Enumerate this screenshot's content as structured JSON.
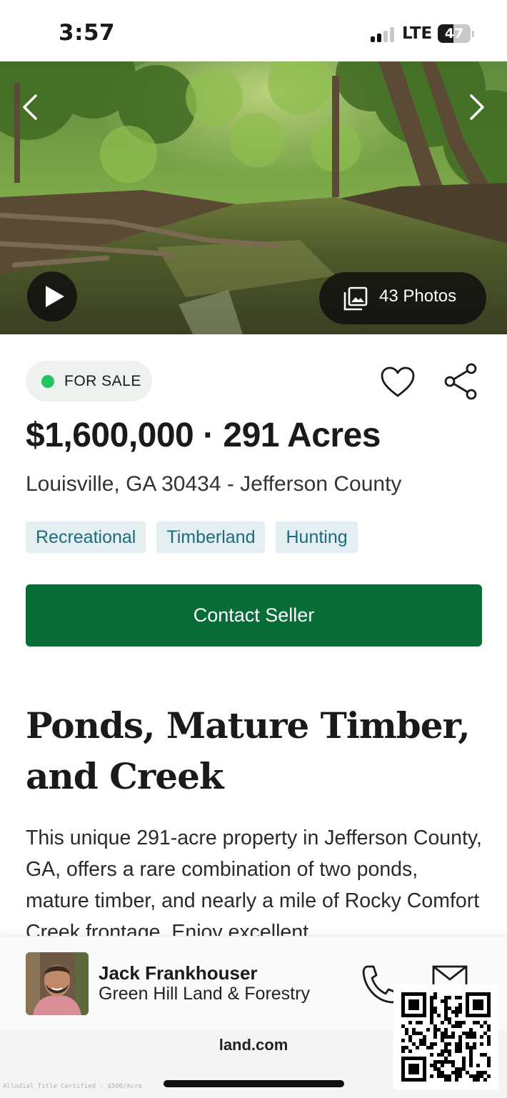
{
  "status_bar": {
    "time": "3:57",
    "network": "LTE",
    "battery": "47",
    "battery_level": 0.47
  },
  "gallery": {
    "photos_label": "43 Photos",
    "prev_icon": "chevron-left-icon",
    "next_icon": "chevron-right-icon",
    "play_icon": "play-icon",
    "photos_icon": "gallery-icon"
  },
  "listing": {
    "status": "FOR SALE",
    "price_line": "$1,600,000 · 291 Acres",
    "address": "Louisville, GA 30434 - Jefferson County",
    "tags": [
      "Recreational",
      "Timberland",
      "Hunting"
    ],
    "contact_label": "Contact Seller",
    "headline": "Ponds, Mature Timber, and Creek",
    "description": "This unique 291-acre property in Jefferson County, GA, offers a rare combination of two ponds, mature timber, and nearly a mile of Rocky Comfort Creek frontage. Enjoy excellent"
  },
  "agent": {
    "name": "Jack Frankhouser",
    "company": "Green Hill Land & Forestry"
  },
  "footer": {
    "site": "land.com",
    "fine_print": "Allodial Title Certified - $500/Acre"
  },
  "colors": {
    "accent_green": "#076c35",
    "status_dot": "#21c55d",
    "tag_bg": "#e3eff1",
    "tag_text": "#1f6b7d"
  }
}
